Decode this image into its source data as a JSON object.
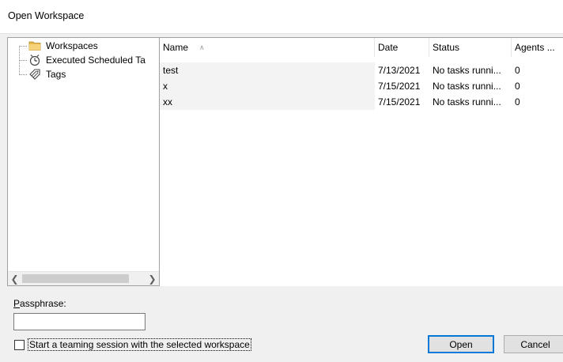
{
  "window": {
    "title": "Open Workspace"
  },
  "tree": {
    "items": [
      {
        "label": "Workspaces",
        "icon": "folder-icon"
      },
      {
        "label": "Executed Scheduled Ta",
        "icon": "scheduled-task-icon"
      },
      {
        "label": "Tags",
        "icon": "tag-icon"
      }
    ]
  },
  "list": {
    "columns": [
      {
        "label": "Name"
      },
      {
        "label": "Date"
      },
      {
        "label": "Status"
      },
      {
        "label": "Agents ..."
      }
    ],
    "sort_indicator": "∧",
    "rows": [
      {
        "name": "test",
        "date": "7/13/2021",
        "status": "No tasks runni...",
        "agents": "0"
      },
      {
        "name": "x",
        "date": "7/15/2021",
        "status": "No tasks runni...",
        "agents": "0"
      },
      {
        "name": "xx",
        "date": "7/15/2021",
        "status": "No tasks runni...",
        "agents": "0"
      }
    ]
  },
  "passphrase": {
    "label_first": "P",
    "label_rest": "assphrase:",
    "value": ""
  },
  "teaming": {
    "label": "Start a teaming session with the selected workspace",
    "checked": false
  },
  "buttons": {
    "open": "Open",
    "cancel": "Cancel"
  },
  "colors": {
    "accent": "#0078d7",
    "row_selection": "#f3f3f3"
  }
}
